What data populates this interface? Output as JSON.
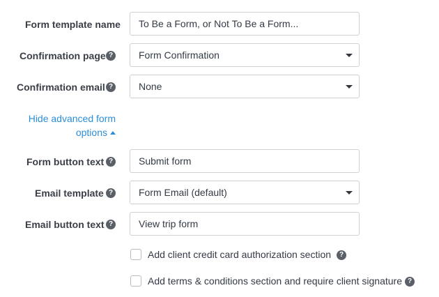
{
  "form": {
    "template_name": {
      "label": "Form template name",
      "value": "To Be a Form, or Not To Be a Form..."
    },
    "confirmation_page": {
      "label": "Confirmation page",
      "value": "Form Confirmation"
    },
    "confirmation_email": {
      "label": "Confirmation email",
      "value": "None"
    },
    "advanced_toggle": {
      "line1": "Hide advanced form",
      "line2": "options"
    },
    "button_text": {
      "label": "Form button text",
      "value": "Submit form"
    },
    "email_template": {
      "label": "Email template",
      "value": "Form Email (default)"
    },
    "email_button_text": {
      "label": "Email button text",
      "value": "View trip form"
    },
    "checkbox_credit_card": {
      "label": "Add client credit card authorization section",
      "checked": false
    },
    "checkbox_terms": {
      "label": "Add terms & conditions section and require client signature",
      "checked": false
    }
  },
  "icons": {
    "help": "?"
  },
  "colors": {
    "link": "#2b8ed8",
    "help_bg": "#5b6068",
    "border": "#cdd1d6"
  }
}
